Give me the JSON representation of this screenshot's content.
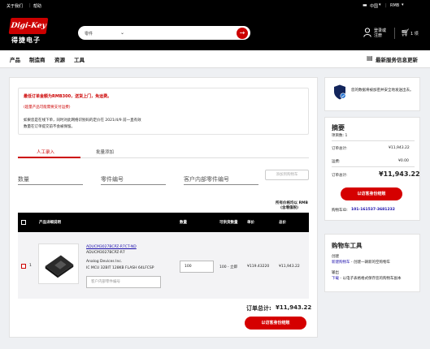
{
  "topbar": {
    "about": "关于我们",
    "help": "帮助",
    "country": "中国",
    "currency": "RMB"
  },
  "header": {
    "logo_text": "Digi-Key",
    "logo_cn": "得捷电子",
    "search_category": "零件",
    "search_placeholder": "",
    "login_line1": "登录或",
    "login_line2": "注册",
    "cart_count": "1 项"
  },
  "nav": {
    "items": [
      "产品",
      "制造商",
      "资源",
      "工具"
    ],
    "news": "最新服务信息更新"
  },
  "notice": {
    "headline": "最低订单金额为RMB300，送货上门，免运费。",
    "subline": "(超量产品可能需要支付运费)",
    "body1": "如果您是在线下单，同时对此网络识别码的定价在 2021/4/9 前一直有效",
    "body2": "数量在订单提交前不会被保留。"
  },
  "tabs": {
    "manual": "人工录入",
    "batch": "批量添加"
  },
  "form": {
    "qty": "数量",
    "part": "零件编号",
    "customer_part": "客户内部零件编号",
    "add_button": "添加到购物车"
  },
  "price_note": {
    "line1": "所有价格均以 RMB",
    "line2": "(含增值税)"
  },
  "table": {
    "headers": [
      "产品详细说明",
      "数量",
      "可供货数量",
      "单价",
      "总价"
    ],
    "row": {
      "index": "1",
      "digikey_pn": "ADUCM3027BCPZ-R7CT-ND",
      "mfr_pn": "ADUCM3027BCPZ-R7",
      "mfr": "Analog Devices Inc.",
      "desc": "IC MCU 32BIT 128KB FLASH 64LFCSP",
      "customer_pn_placeholder": "客户内部零件编号",
      "qty": "100",
      "available": "100 - 立即",
      "unit_price": "¥119.43220",
      "total": "¥11,943.22"
    }
  },
  "order_total": {
    "label": "订单总计:",
    "value": "¥11,943.22"
  },
  "checkout_label": "以访客身份结账",
  "security": {
    "text": "您的数据将被加密并安全地发送出去。"
  },
  "summary": {
    "title": "摘要",
    "items": "项目数:  1",
    "order_total_label": "订单总计:",
    "order_total_value": "¥11,943.22",
    "shipping_label": "运费:",
    "shipping_value": "¥0.00",
    "total_label": "订单总计:",
    "total_value": "¥11,943.22",
    "checkout": "以访客身份结账",
    "cart_id_label": "购物车ID:",
    "cart_id": "101-161537-3681232"
  },
  "tools": {
    "title": "购物车工具",
    "create_label": "创建",
    "create_link": "新建购物车",
    "create_desc": " - 创建一辆新的空购物车",
    "export_label": "输出",
    "export_link": "下载",
    "export_desc": " - 以电子表格格式保存您的购物车副本"
  },
  "colors": {
    "brand_red": "#cc0000",
    "header_black": "#000000",
    "link_blue": "#1a0dab"
  }
}
